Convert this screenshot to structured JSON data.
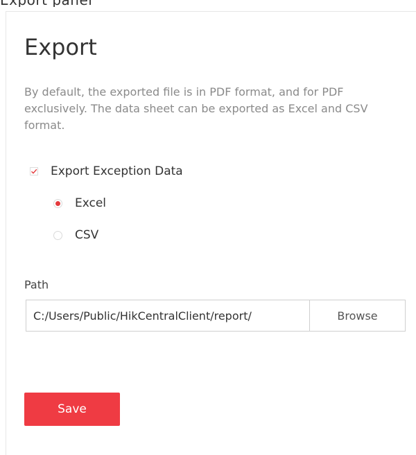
{
  "top_fragment": "Export panel",
  "export": {
    "title": "Export",
    "description": "By default, the exported file is in PDF format, and for PDF exclusively. The data sheet can be exported as Excel and CSV format.",
    "exception_checkbox": {
      "label": "Export Exception Data",
      "checked": true
    },
    "format_options": [
      {
        "label": "Excel",
        "selected": true
      },
      {
        "label": "CSV",
        "selected": false
      }
    ],
    "path": {
      "label": "Path",
      "value": "C:/Users/Public/HikCentralClient/report/",
      "browse_label": "Browse"
    },
    "save_label": "Save"
  },
  "colors": {
    "accent": "#ef3b43",
    "radio_dot": "#e4393c",
    "description_text": "#8a8a8a"
  }
}
